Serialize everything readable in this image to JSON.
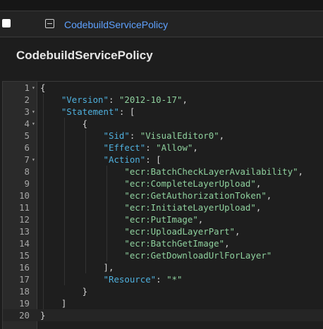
{
  "row": {
    "policy_link": "CodebuildServicePolicy"
  },
  "panel": {
    "title": "CodebuildServicePolicy"
  },
  "editor": {
    "lines": [
      {
        "n": "1",
        "fold": true,
        "tokens": [
          {
            "t": "p",
            "v": "{"
          }
        ]
      },
      {
        "n": "2",
        "fold": false,
        "tokens": [
          {
            "t": "p",
            "v": "    "
          },
          {
            "t": "k",
            "v": "\"Version\""
          },
          {
            "t": "p",
            "v": ": "
          },
          {
            "t": "s",
            "v": "\"2012-10-17\""
          },
          {
            "t": "p",
            "v": ","
          }
        ]
      },
      {
        "n": "3",
        "fold": true,
        "tokens": [
          {
            "t": "p",
            "v": "    "
          },
          {
            "t": "k",
            "v": "\"Statement\""
          },
          {
            "t": "p",
            "v": ": ["
          }
        ]
      },
      {
        "n": "4",
        "fold": true,
        "tokens": [
          {
            "t": "p",
            "v": "        {"
          }
        ]
      },
      {
        "n": "5",
        "fold": false,
        "tokens": [
          {
            "t": "p",
            "v": "            "
          },
          {
            "t": "k",
            "v": "\"Sid\""
          },
          {
            "t": "p",
            "v": ": "
          },
          {
            "t": "s",
            "v": "\"VisualEditor0\""
          },
          {
            "t": "p",
            "v": ","
          }
        ]
      },
      {
        "n": "6",
        "fold": false,
        "tokens": [
          {
            "t": "p",
            "v": "            "
          },
          {
            "t": "k",
            "v": "\"Effect\""
          },
          {
            "t": "p",
            "v": ": "
          },
          {
            "t": "s",
            "v": "\"Allow\""
          },
          {
            "t": "p",
            "v": ","
          }
        ]
      },
      {
        "n": "7",
        "fold": true,
        "tokens": [
          {
            "t": "p",
            "v": "            "
          },
          {
            "t": "k",
            "v": "\"Action\""
          },
          {
            "t": "p",
            "v": ": ["
          }
        ]
      },
      {
        "n": "8",
        "fold": false,
        "tokens": [
          {
            "t": "p",
            "v": "                "
          },
          {
            "t": "s",
            "v": "\"ecr:BatchCheckLayerAvailability\""
          },
          {
            "t": "p",
            "v": ","
          }
        ]
      },
      {
        "n": "9",
        "fold": false,
        "tokens": [
          {
            "t": "p",
            "v": "                "
          },
          {
            "t": "s",
            "v": "\"ecr:CompleteLayerUpload\""
          },
          {
            "t": "p",
            "v": ","
          }
        ]
      },
      {
        "n": "10",
        "fold": false,
        "tokens": [
          {
            "t": "p",
            "v": "                "
          },
          {
            "t": "s",
            "v": "\"ecr:GetAuthorizationToken\""
          },
          {
            "t": "p",
            "v": ","
          }
        ]
      },
      {
        "n": "11",
        "fold": false,
        "tokens": [
          {
            "t": "p",
            "v": "                "
          },
          {
            "t": "s",
            "v": "\"ecr:InitiateLayerUpload\""
          },
          {
            "t": "p",
            "v": ","
          }
        ]
      },
      {
        "n": "12",
        "fold": false,
        "tokens": [
          {
            "t": "p",
            "v": "                "
          },
          {
            "t": "s",
            "v": "\"ecr:PutImage\""
          },
          {
            "t": "p",
            "v": ","
          }
        ]
      },
      {
        "n": "13",
        "fold": false,
        "tokens": [
          {
            "t": "p",
            "v": "                "
          },
          {
            "t": "s",
            "v": "\"ecr:UploadLayerPart\""
          },
          {
            "t": "p",
            "v": ","
          }
        ]
      },
      {
        "n": "14",
        "fold": false,
        "tokens": [
          {
            "t": "p",
            "v": "                "
          },
          {
            "t": "s",
            "v": "\"ecr:BatchGetImage\""
          },
          {
            "t": "p",
            "v": ","
          }
        ]
      },
      {
        "n": "15",
        "fold": false,
        "tokens": [
          {
            "t": "p",
            "v": "                "
          },
          {
            "t": "s",
            "v": "\"ecr:GetDownloadUrlForLayer\""
          }
        ]
      },
      {
        "n": "16",
        "fold": false,
        "tokens": [
          {
            "t": "p",
            "v": "            ],"
          }
        ]
      },
      {
        "n": "17",
        "fold": false,
        "tokens": [
          {
            "t": "p",
            "v": "            "
          },
          {
            "t": "k",
            "v": "\"Resource\""
          },
          {
            "t": "p",
            "v": ": "
          },
          {
            "t": "s",
            "v": "\"*\""
          }
        ]
      },
      {
        "n": "18",
        "fold": false,
        "tokens": [
          {
            "t": "p",
            "v": "        }"
          }
        ]
      },
      {
        "n": "19",
        "fold": false,
        "tokens": [
          {
            "t": "p",
            "v": "    ]"
          }
        ]
      },
      {
        "n": "20",
        "fold": false,
        "active": true,
        "tokens": [
          {
            "t": "p",
            "v": "}"
          }
        ]
      }
    ]
  }
}
